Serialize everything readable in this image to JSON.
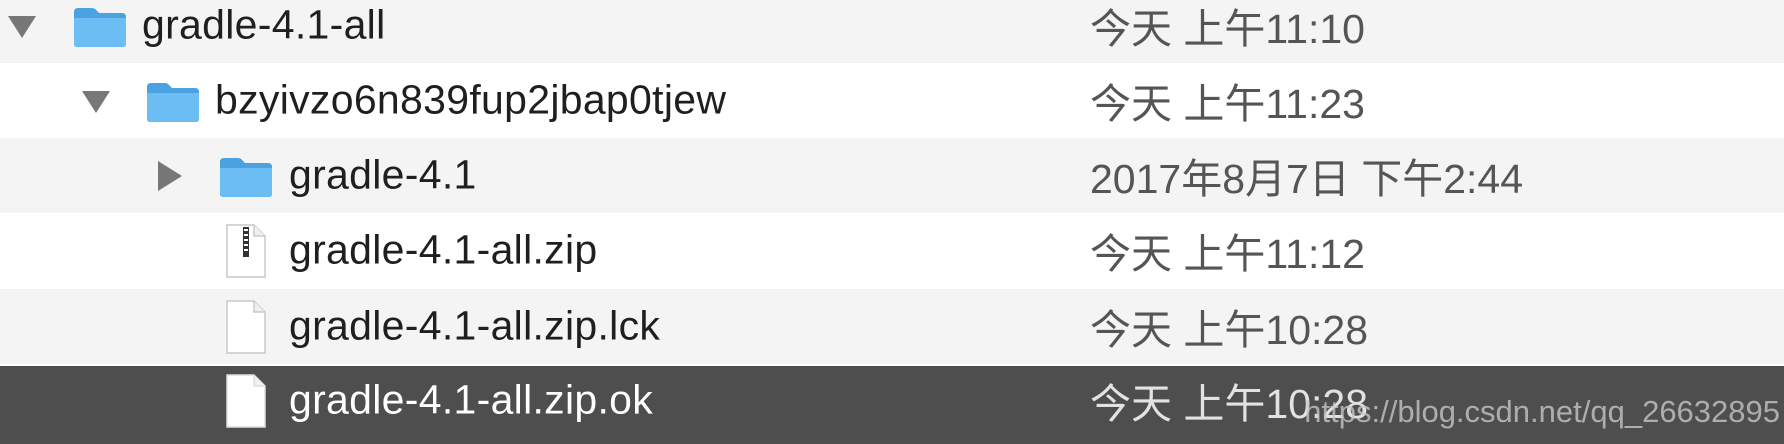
{
  "rows": [
    {
      "name": "gradle-4.1-all",
      "date": "今天 上午11:10",
      "kind": "folder",
      "disclosure": "expanded"
    },
    {
      "name": "bzyivzo6n839fup2jbap0tjew",
      "date": "今天 上午11:23",
      "kind": "folder",
      "disclosure": "expanded"
    },
    {
      "name": "gradle-4.1",
      "date": "2017年8月7日 下午2:44",
      "kind": "folder",
      "disclosure": "collapsed"
    },
    {
      "name": "gradle-4.1-all.zip",
      "date": "今天 上午11:12",
      "kind": "zip-file"
    },
    {
      "name": "gradle-4.1-all.zip.lck",
      "date": "今天 上午10:28",
      "kind": "file"
    },
    {
      "name": "gradle-4.1-all.zip.ok",
      "date": "今天 上午10:28",
      "kind": "file",
      "selected": true
    }
  ],
  "watermark": "https://blog.csdn.net/qq_26632895",
  "colors": {
    "folder": "#5fb4ee",
    "selection": "#4e4e4e",
    "stripe": "#f4f4f4"
  }
}
